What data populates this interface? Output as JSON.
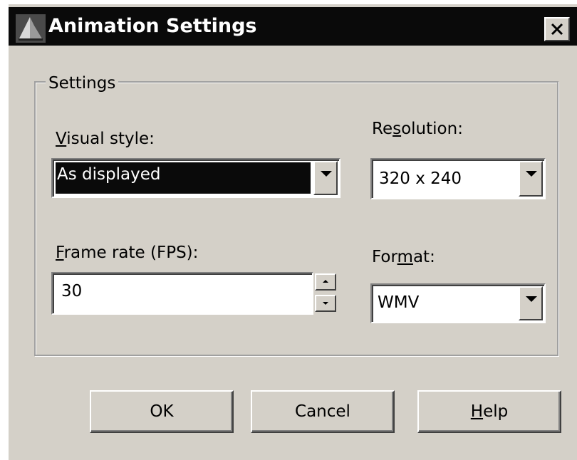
{
  "window": {
    "title": "Animation Settings",
    "close_glyph": "✕",
    "app_icon": "app-icon"
  },
  "group": {
    "legend": "Settings"
  },
  "visual_style": {
    "label_mnemonic": "V",
    "label_rest": "isual style:",
    "value": "As displayed"
  },
  "resolution": {
    "label_before": "Re",
    "label_mnemonic": "s",
    "label_after": "olution:",
    "value": "320 x 240"
  },
  "frame_rate": {
    "label_mnemonic": "F",
    "label_rest": "rame rate (FPS):",
    "value": "30"
  },
  "format": {
    "label_before": "For",
    "label_mnemonic": "m",
    "label_after": "at:",
    "value": "WMV"
  },
  "buttons": {
    "ok": "OK",
    "cancel": "Cancel",
    "help_mnemonic": "H",
    "help_rest": "elp"
  },
  "colors": {
    "face": "#d4d0c8",
    "titlebar": "#0a0a0a",
    "highlight": "#0a0a0a"
  }
}
